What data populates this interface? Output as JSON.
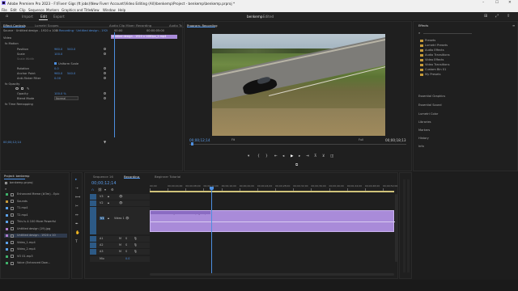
{
  "app": {
    "title": "Adobe Premiere Pro 2023 - F:\\Fiverr Gigs (ft jobs)\\New Fiverr Account\\Video Editing (All)\\benkemp\\Project - benkemp\\benkemp.prproj *"
  },
  "menu": [
    "File",
    "Edit",
    "Clip",
    "Sequence",
    "Markers",
    "Graphics and Titles",
    "View",
    "Window",
    "Help"
  ],
  "workspace": {
    "tabs": [
      "Import",
      "Edit",
      "Export"
    ],
    "center_title": "benkemp",
    "center_suffix": "- Edited"
  },
  "effect_controls": {
    "tabs": [
      "Effect Controls",
      "Lumetri Scopes",
      "Audio Clip Mixer: Recording",
      "Audio Track Mixer: Recording"
    ],
    "source_line": "Source · Untitled design - 1920 x 1080...",
    "sequence_line": "Recording · Untitled design - 1920...",
    "time_marks": [
      "00:00",
      "00:00:05:00"
    ],
    "clip_bar_label": "Untitled design - 1920 x 1080px_2.mp4",
    "section_video": "Video",
    "fx_motion": "fx  Motion",
    "position_label": "Position",
    "position_values": [
      "960.0",
      "540.0"
    ],
    "scale_label": "Scale",
    "scale_value": "100.0",
    "scale_width_label": "Scale Width",
    "uniform_scale_label": "Uniform Scale",
    "rotation_label": "Rotation",
    "rotation_value": "0.0",
    "anchor_label": "Anchor Point",
    "anchor_values": [
      "960.0",
      "540.0"
    ],
    "antiflicker_label": "Anti-flicker Filter",
    "antiflicker_value": "0.00",
    "fx_opacity": "fx  Opacity",
    "opacity_label": "Opacity",
    "opacity_value": "100.0 %",
    "blend_label": "Blend Mode",
    "blend_value": "Normal",
    "time_remap": "fx  Time Remapping",
    "timecode": "00;00;12;14"
  },
  "program": {
    "tab": "Program: Recording",
    "timecode_left": "00;00;12;14",
    "fit": "Fit",
    "quality": "Full",
    "timecode_right": "00;00;18;13"
  },
  "effects_panel": {
    "title": "Effects",
    "search_placeholder": "",
    "items": [
      "Presets",
      "Lumetri Presets",
      "Audio Effects",
      "Audio Transitions",
      "Video Effects",
      "Video Transitions",
      "Custom Bin 01",
      "My Presets"
    ],
    "sections": [
      "Essential Graphics",
      "Essential Sound",
      "Lumetri Color",
      "Libraries",
      "Markers",
      "History",
      "Info"
    ]
  },
  "project": {
    "title": "Project: benkemp",
    "file": "benkemp.prproj",
    "items": [
      {
        "name": "Enhanced Meme (#3m) - Epic",
        "color": "#3fb06a"
      },
      {
        "name": "Sounds",
        "color": "#c59a3a"
      },
      {
        "name": "T1.mp4",
        "color": "#5aa0e8"
      },
      {
        "name": "T2.mp4",
        "color": "#5aa0e8"
      },
      {
        "name": "This Is A 100 More Powerful",
        "color": "#5aa0e8"
      },
      {
        "name": "Untitled design (19).jpg",
        "color": "#b07acb"
      },
      {
        "name": "Untitled design - 1920 x 10",
        "color": "#b07acb"
      },
      {
        "name": "Video_1.mp4",
        "color": "#5aa0e8"
      },
      {
        "name": "Video_2.mp4",
        "color": "#5aa0e8"
      },
      {
        "name": "VO 01.mp3",
        "color": "#3fb06a"
      },
      {
        "name": "Voice (Enhanced Dow...",
        "color": "#3fb06a"
      }
    ]
  },
  "timeline": {
    "tabs": [
      "Sequence 16",
      "Recording",
      "Beginner Tutorial"
    ],
    "timecode": "00;00;12;14",
    "ruler": [
      "00;00",
      "00;00;04;00",
      "00;00;08;00",
      "00;00;12;00",
      "00;00;16;00",
      "00;00;20;00",
      "00;00;24;00",
      "00;00;28;00",
      "00;00;32;00",
      "00;00;36;00",
      "00;00;40;00",
      "00;00;44;00",
      "00;00;48;00",
      "00;00;52;00"
    ],
    "video_tracks": [
      "V3",
      "V2",
      "V1"
    ],
    "audio_tracks": [
      "A1",
      "A2",
      "A3"
    ],
    "v1_label": "Video 1",
    "mix_label": "Mix",
    "mix_value": "0.0",
    "clip_label": "Untitled design - 1920 x 1080px_2.mp4"
  },
  "colors": {
    "accent": "#4d8fe0",
    "clip": "#a98bd9",
    "clip_dark": "#8a6bc2"
  }
}
